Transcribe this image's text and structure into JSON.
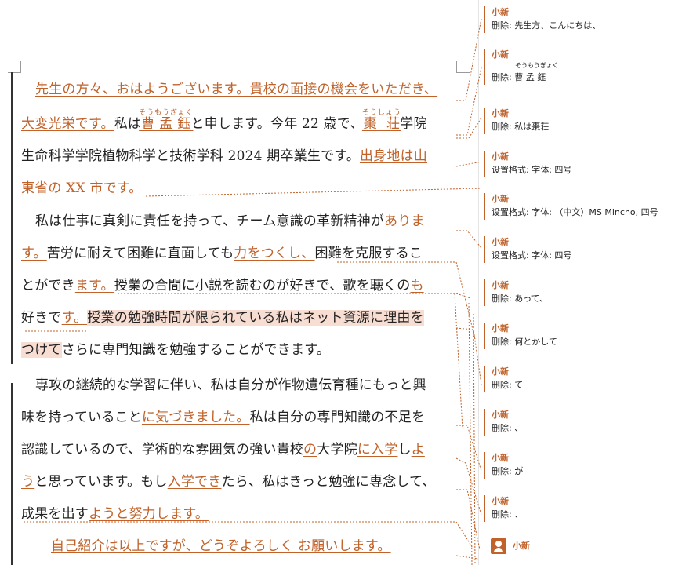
{
  "document": {
    "p1": {
      "l1": {
        "a": "先生の方々、おはようございます。貴校の面接の機会をいただき、"
      },
      "l2": {
        "a": "大変光栄です。",
        "b": "私は",
        "r1": "曹孟鈺",
        "r1t": "そうもうぎょく",
        "c": "と申します。今年 22 歳で、",
        "r2": "棗 荘",
        "r2t": "そうしょう",
        "d": "学院"
      },
      "l3": {
        "a": "生命科学学院植物科学と技術学科 2024 期卒業生です。",
        "b": "出身地は山"
      },
      "l4": {
        "a": "東省の XX 市です。"
      }
    },
    "p2": {
      "l1": {
        "a": "私は仕事に真剣に責任を持って、チーム意識の革新精神が",
        "b": "ありま"
      },
      "l2": {
        "a": "す。",
        "b": "苦労に耐えて困難に直面しても",
        "c": "力をつくし、",
        "d": "困難を克服するこ"
      },
      "l3": {
        "a": "とができ",
        "b": "ます。",
        "c": "授業の合間に小説を読むのが好きで、歌を聴くの",
        "d": "も"
      },
      "l4": {
        "a": "好きで",
        "b": "す。",
        "c": "授業の勉強時間が限られている私はネット資源に理由を"
      },
      "l5": {
        "a": "つけて",
        "b": "さらに専門知識を勉強することができます。"
      }
    },
    "p3": {
      "l1": {
        "a": "専攻の継続的な学習に伴い、私は自分が作物遺伝育種にもっと興"
      },
      "l2": {
        "a": "味を持っていること",
        "b": "に気づきました。",
        "c": "私は自分の専門知識の不足を"
      },
      "l3": {
        "a": "認識しているので、学術的な雰囲気の強い貴校",
        "b": "の",
        "c": "大学院",
        "d": "に入学",
        "e": "し",
        "f": "よ"
      },
      "l4": {
        "a": "う",
        "b": "と思っています。もし",
        "c": "入学でき",
        "d": "たら、私はきっと勉強に専念して、"
      },
      "l5": {
        "a": "成果を出す",
        "b": "ようと努力します。"
      }
    },
    "p4": {
      "l1": {
        "a": "自己紹介は以上ですが、どうぞよろしく お願いします。"
      }
    }
  },
  "comments": [
    {
      "author": "小新",
      "action": "删除: 先生方、こんにちは、"
    },
    {
      "author": "小新",
      "ruby": "そうもうぎょく",
      "action": "删除: 曹 孟 鈺"
    },
    {
      "author": "小新",
      "action": "删除: 私は棗荘"
    },
    {
      "author": "小新",
      "action": "设置格式: 字体: 四号"
    },
    {
      "author": "小新",
      "action": "设置格式: 字体: （中文）MS Mincho, 四号"
    },
    {
      "author": "小新",
      "action": "设置格式: 字体: 四号"
    },
    {
      "author": "小新",
      "action": "删除: あって、"
    },
    {
      "author": "小新",
      "action": "删除: 何とかして"
    },
    {
      "author": "小新",
      "action": "删除: て"
    },
    {
      "author": "小新",
      "action": "删除: 、"
    },
    {
      "author": "小新",
      "action": "删除: が"
    },
    {
      "author": "小新",
      "action": "删除: 、"
    }
  ],
  "footer_author": "小新",
  "colors": {
    "revision": "#c0622a",
    "highlight": "#f7ddd2",
    "text": "#222222"
  }
}
